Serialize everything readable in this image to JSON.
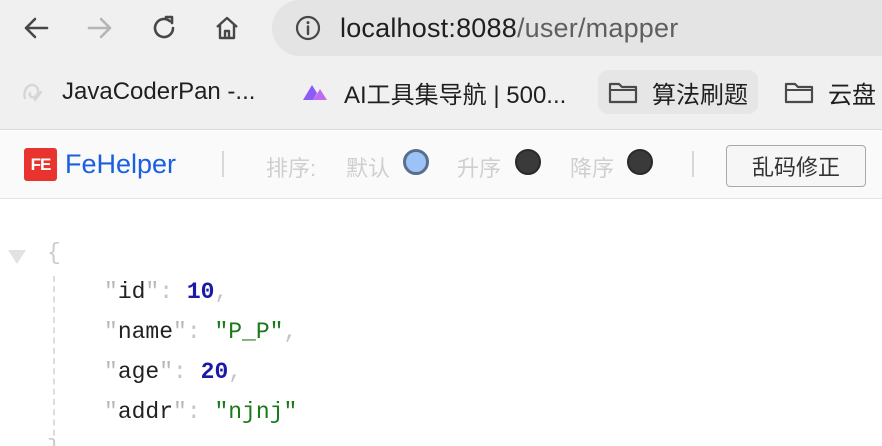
{
  "browser": {
    "url_host": "localhost:8088",
    "url_path": "/user/mapper"
  },
  "bookmarks": [
    {
      "label": "JavaCoderPan -...",
      "icon": "logo-icon"
    },
    {
      "label": "AI工具集导航 | 500...",
      "icon": "ai-logo-icon"
    },
    {
      "label": "算法刷题",
      "icon": "folder-icon"
    },
    {
      "label": "云盘",
      "icon": "folder-icon"
    }
  ],
  "fehelper": {
    "brand_badge": "FE",
    "brand_name": "FeHelper",
    "sort_label": "排序:",
    "sort_options": [
      {
        "label": "默认",
        "checked": true
      },
      {
        "label": "升序",
        "checked": false
      },
      {
        "label": "降序",
        "checked": false
      }
    ],
    "fix_encoding_label": "乱码修正"
  },
  "json": {
    "open_brace": "{",
    "close_brace": "}",
    "entries": [
      {
        "key": "id",
        "value": "10",
        "type": "number"
      },
      {
        "key": "name",
        "value": "\"P_P\"",
        "type": "string"
      },
      {
        "key": "age",
        "value": "20",
        "type": "number"
      },
      {
        "key": "addr",
        "value": "\"njnj\"",
        "type": "string"
      }
    ]
  }
}
